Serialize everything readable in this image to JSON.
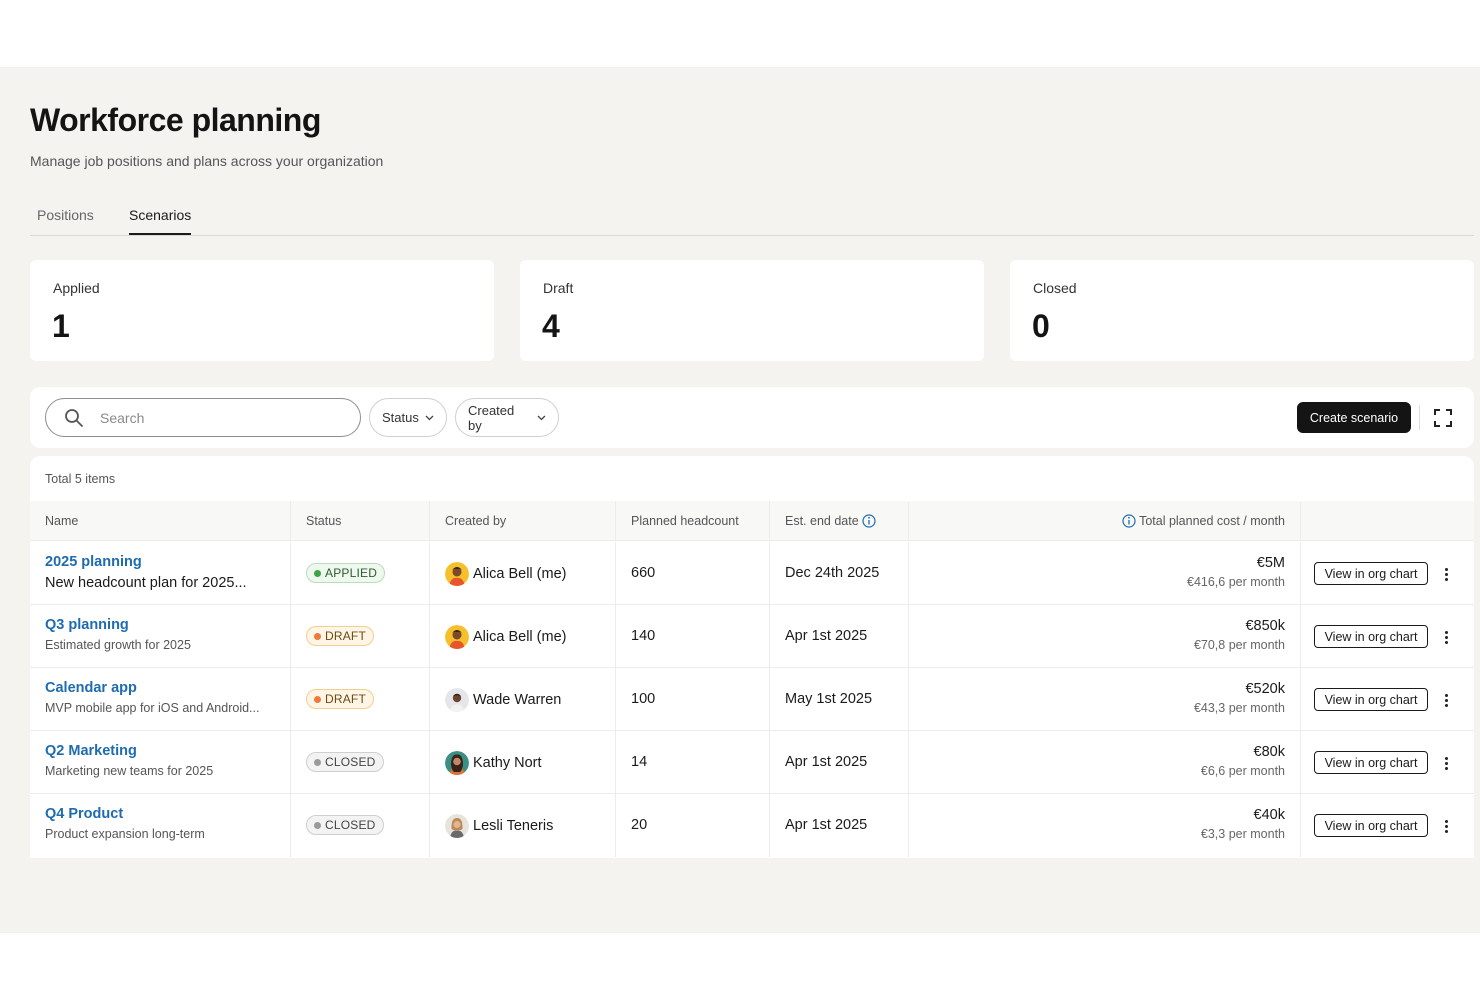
{
  "header": {
    "title": "Workforce planning",
    "subtitle": "Manage job positions and plans across your organization"
  },
  "tabs": [
    {
      "label": "Positions",
      "active": false
    },
    {
      "label": "Scenarios",
      "active": true
    }
  ],
  "summary": [
    {
      "label": "Applied",
      "value": "1"
    },
    {
      "label": "Draft",
      "value": "4"
    },
    {
      "label": "Closed",
      "value": "0"
    }
  ],
  "toolbar": {
    "search_placeholder": "Search",
    "filter_status": "Status",
    "filter_created_by": "Created by",
    "create_label": "Create scenario"
  },
  "table": {
    "total": "Total 5 items",
    "columns": {
      "name": "Name",
      "status": "Status",
      "created_by": "Created by",
      "headcount": "Planned headcount",
      "end_date": "Est. end date",
      "cost": "Total planned cost / month"
    },
    "action_label": "View in org chart",
    "rows": [
      {
        "title": "2025 planning",
        "desc": "New headcount plan for 2025...",
        "status": "APPLIED",
        "creator": "Alica Bell (me)",
        "headcount": "660",
        "end_date": "Dec 24th 2025",
        "cost": "€5M",
        "cost_month": "€416,6 per month"
      },
      {
        "title": "Q3 planning",
        "desc": "Estimated growth for 2025",
        "status": "DRAFT",
        "creator": "Alica Bell (me)",
        "headcount": "140",
        "end_date": "Apr 1st 2025",
        "cost": "€850k",
        "cost_month": "€70,8 per month"
      },
      {
        "title": "Calendar app",
        "desc": "MVP mobile app for iOS and Android...",
        "status": "DRAFT",
        "creator": "Wade Warren",
        "headcount": "100",
        "end_date": "May 1st 2025",
        "cost": "€520k",
        "cost_month": "€43,3 per month"
      },
      {
        "title": "Q2 Marketing",
        "desc": "Marketing new teams for 2025",
        "status": "CLOSED",
        "creator": "Kathy Nort",
        "headcount": "14",
        "end_date": "Apr 1st 2025",
        "cost": "€80k",
        "cost_month": "€6,6 per month"
      },
      {
        "title": "Q4 Product",
        "desc": "Product expansion long-term",
        "status": "CLOSED",
        "creator": "Lesli Teneris",
        "headcount": "20",
        "end_date": "Apr 1st 2025",
        "cost": "€40k",
        "cost_month": "€3,3 per month"
      }
    ]
  },
  "colors": {
    "link": "#1e6bb0",
    "applied": "#3aa547",
    "draft": "#ee7a3a",
    "closed": "#9a9a9a",
    "primary_button": "#141414"
  }
}
